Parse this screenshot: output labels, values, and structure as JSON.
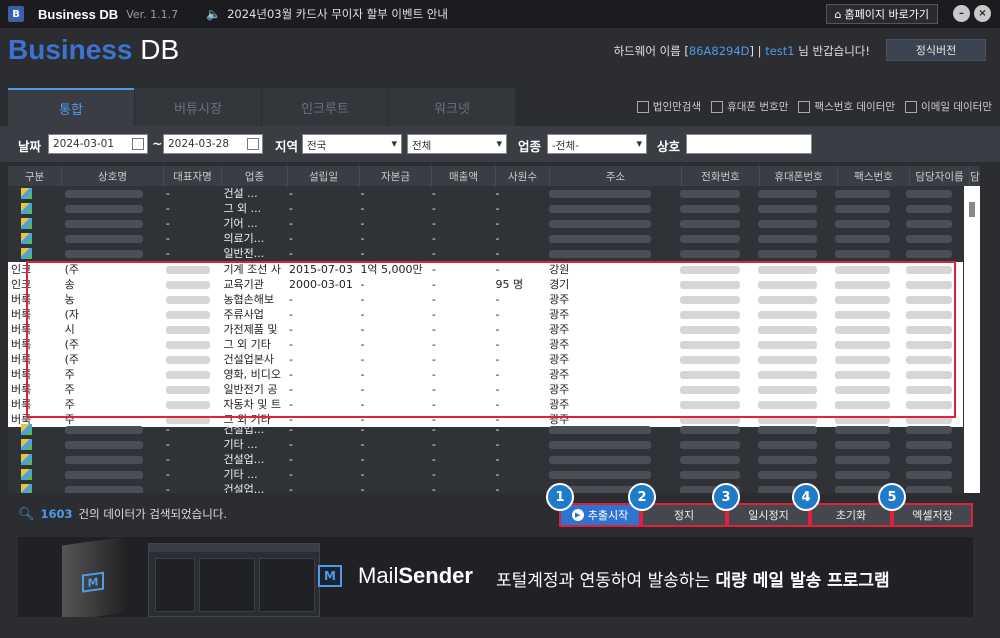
{
  "titlebar": {
    "logo_letter": "B",
    "app_name": "Business DB",
    "version": "Ver. 1.1.7",
    "notice": "2024년03월 카드사 무이자 할부 이벤트 안내",
    "home_button": "홈페이지 바로가기",
    "minimize": "–",
    "close": "×"
  },
  "header": {
    "brand_blue": "Business",
    "brand_white": "DB",
    "hw_prefix": "하드웨어 이름 [",
    "hw_code": "86A8294D",
    "hw_mid": "] | ",
    "user": "test1",
    "hw_suffix": " 님 반갑습니다!",
    "license_button": "정식버전"
  },
  "tabs": [
    "통합",
    "버튜시장",
    "인크루트",
    "워크넷"
  ],
  "filter_checks": [
    "법인만검색",
    "휴대폰 번호만",
    "팩스번호 데이터만",
    "이메일 데이터만"
  ],
  "search": {
    "date_label": "날짜",
    "date_from": "2024-03-01",
    "tilde": "~",
    "date_to": "2024-03-28",
    "region_label": "지역",
    "region1": "전국",
    "region2": "전체",
    "industry_label": "업종",
    "industry": "-전체-",
    "name_label": "상호",
    "name_value": ""
  },
  "columns": [
    "구분",
    "상호명",
    "대표자명",
    "업종",
    "설립일",
    "자본금",
    "매출액",
    "사원수",
    "주소",
    "전화번호",
    "휴대폰번호",
    "팩스번호",
    "담당자이름",
    "담"
  ],
  "rows_top": [
    {
      "industry": "건설 ...",
      "c1": "-",
      "c2": "-",
      "c3": "-",
      "c4": "-",
      "c5": "-"
    },
    {
      "industry": "그 외 ...",
      "c1": "-",
      "c2": "-",
      "c3": "-",
      "c4": "-",
      "c5": "-"
    },
    {
      "industry": "기어 ...",
      "c1": "-",
      "c2": "-",
      "c3": "-",
      "c4": "-",
      "c5": "-"
    },
    {
      "industry": "의료기...",
      "c1": "-",
      "c2": "-",
      "c3": "-",
      "c4": "-",
      "c5": "-"
    },
    {
      "industry": "일반전...",
      "c1": "-",
      "c2": "-",
      "c3": "-",
      "c4": "-",
      "c5": "-"
    }
  ],
  "rows_highlight": [
    {
      "type": "인크",
      "name": "(주",
      "industry": "기계 조선 사",
      "founded": "2015-07-03",
      "capital": "1억 5,000만",
      "sales": "-",
      "staff": "-",
      "addr": "강원"
    },
    {
      "type": "인크",
      "name": "송",
      "industry": "교육기관",
      "founded": "2000-03-01",
      "capital": "-",
      "sales": "-",
      "staff": "95 명",
      "addr": "경기"
    },
    {
      "type": "버룩",
      "name": "농",
      "industry": "농협손해보",
      "founded": "-",
      "capital": "-",
      "sales": "-",
      "staff": "-",
      "addr": "광주"
    },
    {
      "type": "버룩",
      "name": "(자",
      "industry": "주류사업",
      "founded": "-",
      "capital": "-",
      "sales": "-",
      "staff": "-",
      "addr": "광주"
    },
    {
      "type": "버룩",
      "name": "시",
      "industry": "가전제품 및",
      "founded": "-",
      "capital": "-",
      "sales": "-",
      "staff": "-",
      "addr": "광주"
    },
    {
      "type": "버룩",
      "name": "(주",
      "industry": "그 외 기타",
      "founded": "-",
      "capital": "-",
      "sales": "-",
      "staff": "-",
      "addr": "광주"
    },
    {
      "type": "버룩",
      "name": "(주",
      "industry": "건설업본사",
      "founded": "-",
      "capital": "-",
      "sales": "-",
      "staff": "-",
      "addr": "광주"
    },
    {
      "type": "버룩",
      "name": "주",
      "industry": "영화, 비디오",
      "founded": "-",
      "capital": "-",
      "sales": "-",
      "staff": "-",
      "addr": "광주"
    },
    {
      "type": "버룩",
      "name": "주",
      "industry": "일반전기 공",
      "founded": "-",
      "capital": "-",
      "sales": "-",
      "staff": "-",
      "addr": "광주"
    },
    {
      "type": "버룩",
      "name": "주",
      "industry": "자동차 및 트",
      "founded": "-",
      "capital": "-",
      "sales": "-",
      "staff": "-",
      "addr": "광주"
    },
    {
      "type": "버룩",
      "name": "주",
      "industry": "그 외 기타",
      "founded": "-",
      "capital": "-",
      "sales": "-",
      "staff": "-",
      "addr": "광주"
    }
  ],
  "rows_bottom": [
    {
      "industry": "건설업...",
      "c1": "-",
      "c2": "-",
      "c3": "-",
      "c4": "-",
      "c5": "-"
    },
    {
      "industry": "기타 ...",
      "c1": "-",
      "c2": "-",
      "c3": "-",
      "c4": "-",
      "c5": "-"
    },
    {
      "industry": "건설업...",
      "c1": "-",
      "c2": "-",
      "c3": "-",
      "c4": "-",
      "c5": "-"
    },
    {
      "industry": "기타 ...",
      "c1": "-",
      "c2": "-",
      "c3": "-",
      "c4": "-",
      "c5": "-"
    },
    {
      "industry": "건설업...",
      "c1": "-",
      "c2": "-",
      "c3": "-",
      "c4": "-",
      "c5": "-"
    }
  ],
  "status": {
    "count": "1603",
    "text": "건의 데이터가 검색되었습니다."
  },
  "actions": [
    {
      "num": "1",
      "label": "추출시작"
    },
    {
      "num": "2",
      "label": "정지"
    },
    {
      "num": "3",
      "label": "일시정지"
    },
    {
      "num": "4",
      "label": "초기화"
    },
    {
      "num": "5",
      "label": "엑셀저장"
    }
  ],
  "banner": {
    "box_letter": "M",
    "logo_letter": "M",
    "product_light": "Mail",
    "product_bold": "Sender",
    "tagline_normal": "포털계정과 연동하여 발송하는",
    "tagline_bold": "대량 메일 발송 프로그램"
  },
  "colors": {
    "accent": "#4f9be8",
    "highlight_border": "#e0213b",
    "primary_button": "#2f73d0"
  }
}
